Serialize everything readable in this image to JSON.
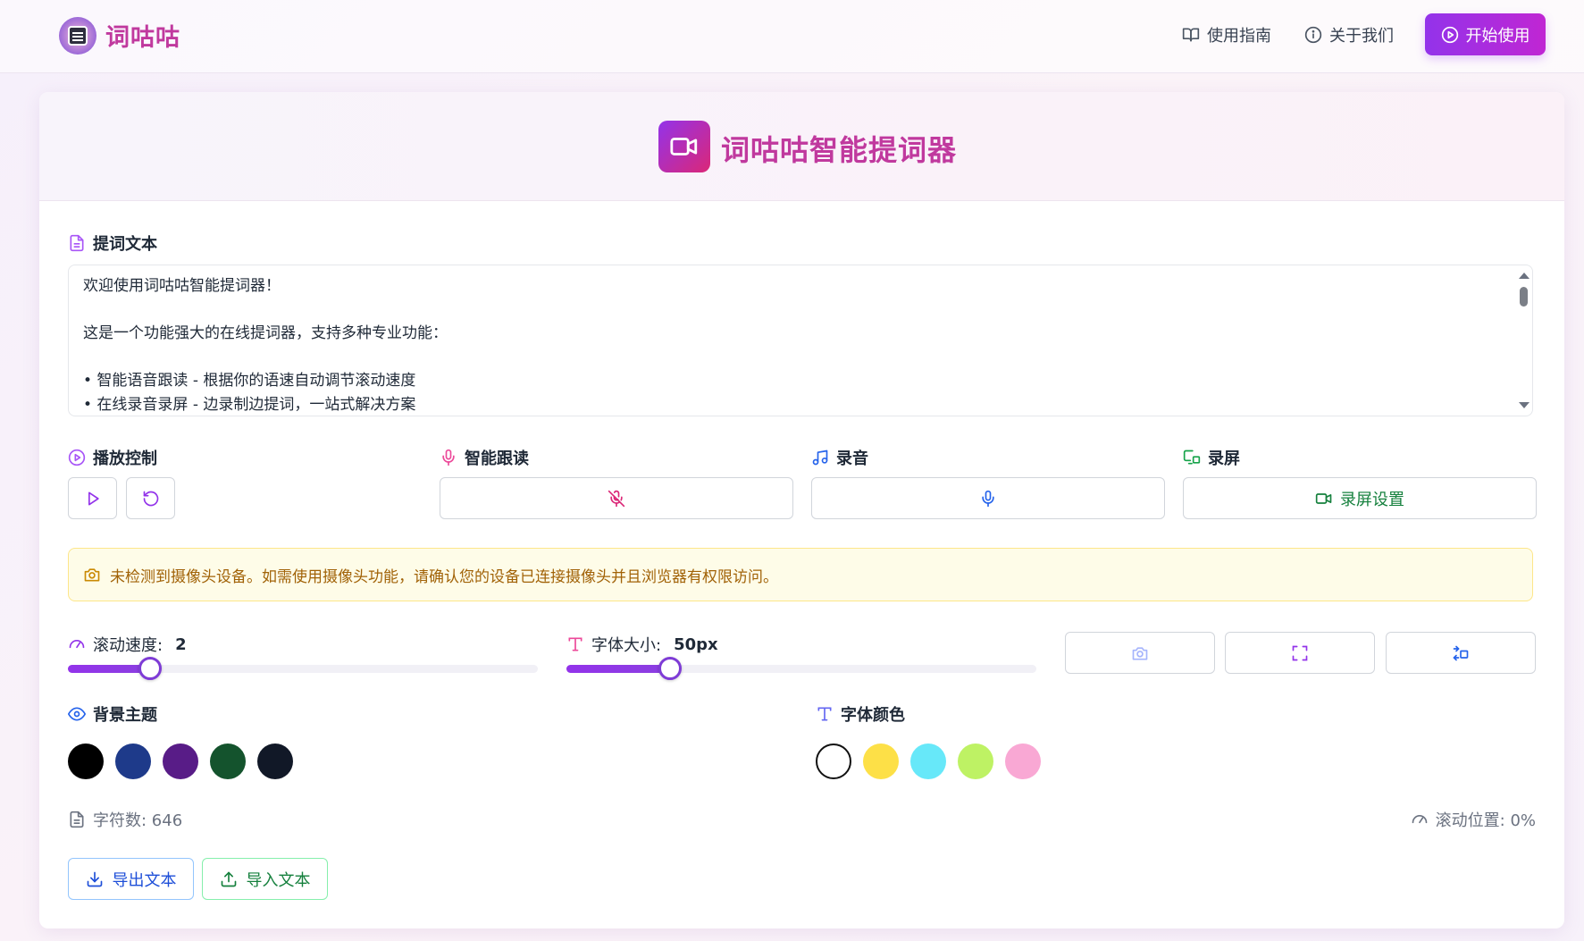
{
  "header": {
    "brand": "词咕咕",
    "nav_guide": "使用指南",
    "nav_about": "关于我们",
    "start_label": "开始使用"
  },
  "card": {
    "title": "词咕咕智能提词器"
  },
  "prompt_text": {
    "label": "提词文本",
    "lines": [
      "欢迎使用词咕咕智能提词器！",
      "",
      "这是一个功能强大的在线提词器，支持多种专业功能：",
      "",
      "• 智能语音跟读 - 根据你的语速自动调节滚动速度",
      "• 在线录音录屏 - 边录制边提词，一站式解决方案"
    ]
  },
  "controls": {
    "playback_label": "播放控制",
    "voice_follow_label": "智能跟读",
    "record_audio_label": "录音",
    "record_screen_label": "录屏",
    "screen_settings_label": "录屏设置"
  },
  "warning": {
    "text": "未检测到摄像头设备。如需使用摄像头功能，请确认您的设备已连接摄像头并且浏览器有权限访问。"
  },
  "sliders": {
    "speed_label": "滚动速度:",
    "speed_value": "2",
    "speed_fraction": 0.175,
    "font_size_label": "字体大小:",
    "font_size_value": "50px",
    "font_size_fraction": 0.22
  },
  "themes": {
    "background_label": "背景主题",
    "background_colors": [
      "#000000",
      "#1e3a8a",
      "#581c87",
      "#14532d",
      "#111827"
    ],
    "font_color_label": "字体颜色",
    "font_colors": [
      "#ffffff",
      "#fde047",
      "#67e8f9",
      "#bef264",
      "#f9a8d4"
    ]
  },
  "stats": {
    "char_count": "字符数: 646",
    "scroll_position": "滚动位置: 0%"
  },
  "io": {
    "export_label": "导出文本",
    "import_label": "导入文本"
  },
  "colors": {
    "accent": "#9333ea",
    "brand_pink": "#c0399e",
    "green": "#15803d",
    "blue": "#1d4ed8",
    "warning_text": "#a16207"
  }
}
